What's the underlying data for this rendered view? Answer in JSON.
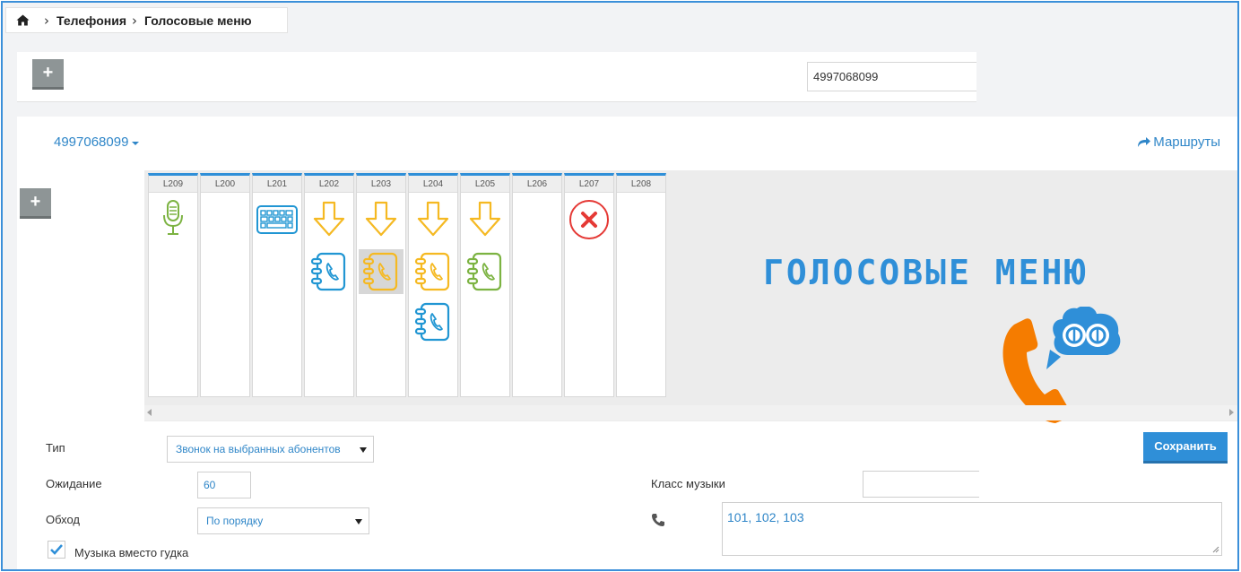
{
  "breadcrumb": {
    "home_icon": "home-icon",
    "items": [
      "Телефония",
      "Голосовые меню"
    ]
  },
  "top_panel": {
    "add_label": "+",
    "search_value": "4997068099"
  },
  "main": {
    "number_dropdown": "4997068099",
    "routes_link": "Маршруты",
    "add_label": "+",
    "columns": [
      {
        "label": "L209",
        "icons": [
          "microphone-icon"
        ]
      },
      {
        "label": "L200",
        "icons": []
      },
      {
        "label": "L201",
        "icons": [
          "keyboard-icon"
        ]
      },
      {
        "label": "L202",
        "icons": [
          "down-arrow-icon",
          "phonebook-icon"
        ]
      },
      {
        "label": "L203",
        "icons": [
          "down-arrow-icon",
          "phonebook-icon"
        ]
      },
      {
        "label": "L204",
        "icons": [
          "down-arrow-icon",
          "phonebook-icon",
          "phonebook-icon"
        ]
      },
      {
        "label": "L205",
        "icons": [
          "down-arrow-icon",
          "phonebook-icon"
        ]
      },
      {
        "label": "L206",
        "icons": []
      },
      {
        "label": "L207",
        "icons": [
          "close-circle-icon"
        ]
      },
      {
        "label": "L208",
        "icons": []
      }
    ],
    "logo_text": "ГОЛОСОВЫЕ МЕНЮ",
    "colors": {
      "accent": "#2f8fd8",
      "yellow": "#f5b922",
      "green": "#7cb342",
      "blue": "#2196d3",
      "red": "#e53935",
      "orange": "#f57c00"
    }
  },
  "form": {
    "type_label": "Тип",
    "type_value": "Звонок на выбранных абонентов",
    "wait_label": "Ожидание",
    "wait_value": "60",
    "order_label": "Обход",
    "order_value": "По порядку",
    "music_checkbox_label": "Музыка вместо гудка",
    "music_checked": true,
    "music_class_label": "Класс музыки",
    "music_class_value": "",
    "numbers_value": "101, 102, 103",
    "save_label": "Сохранить"
  }
}
